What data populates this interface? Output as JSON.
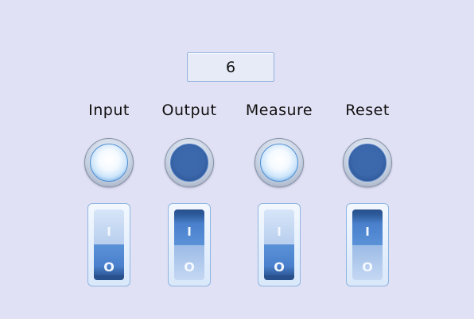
{
  "display": {
    "value": "6"
  },
  "channels": [
    {
      "label": "Input",
      "lamp": "on",
      "switch": "on",
      "switch_top": "I",
      "switch_bottom": "O"
    },
    {
      "label": "Output",
      "lamp": "off",
      "switch": "off",
      "switch_top": "I",
      "switch_bottom": "O"
    },
    {
      "label": "Measure",
      "lamp": "on",
      "switch": "on",
      "switch_top": "I",
      "switch_bottom": "O"
    },
    {
      "label": "Reset",
      "lamp": "off",
      "switch": "off",
      "switch_top": "I",
      "switch_bottom": "O"
    }
  ],
  "colors": {
    "background": "#e1e1f5",
    "accent": "#4a80cc",
    "lamp_on": "#f5faff",
    "lamp_off": "#3b67ab"
  }
}
